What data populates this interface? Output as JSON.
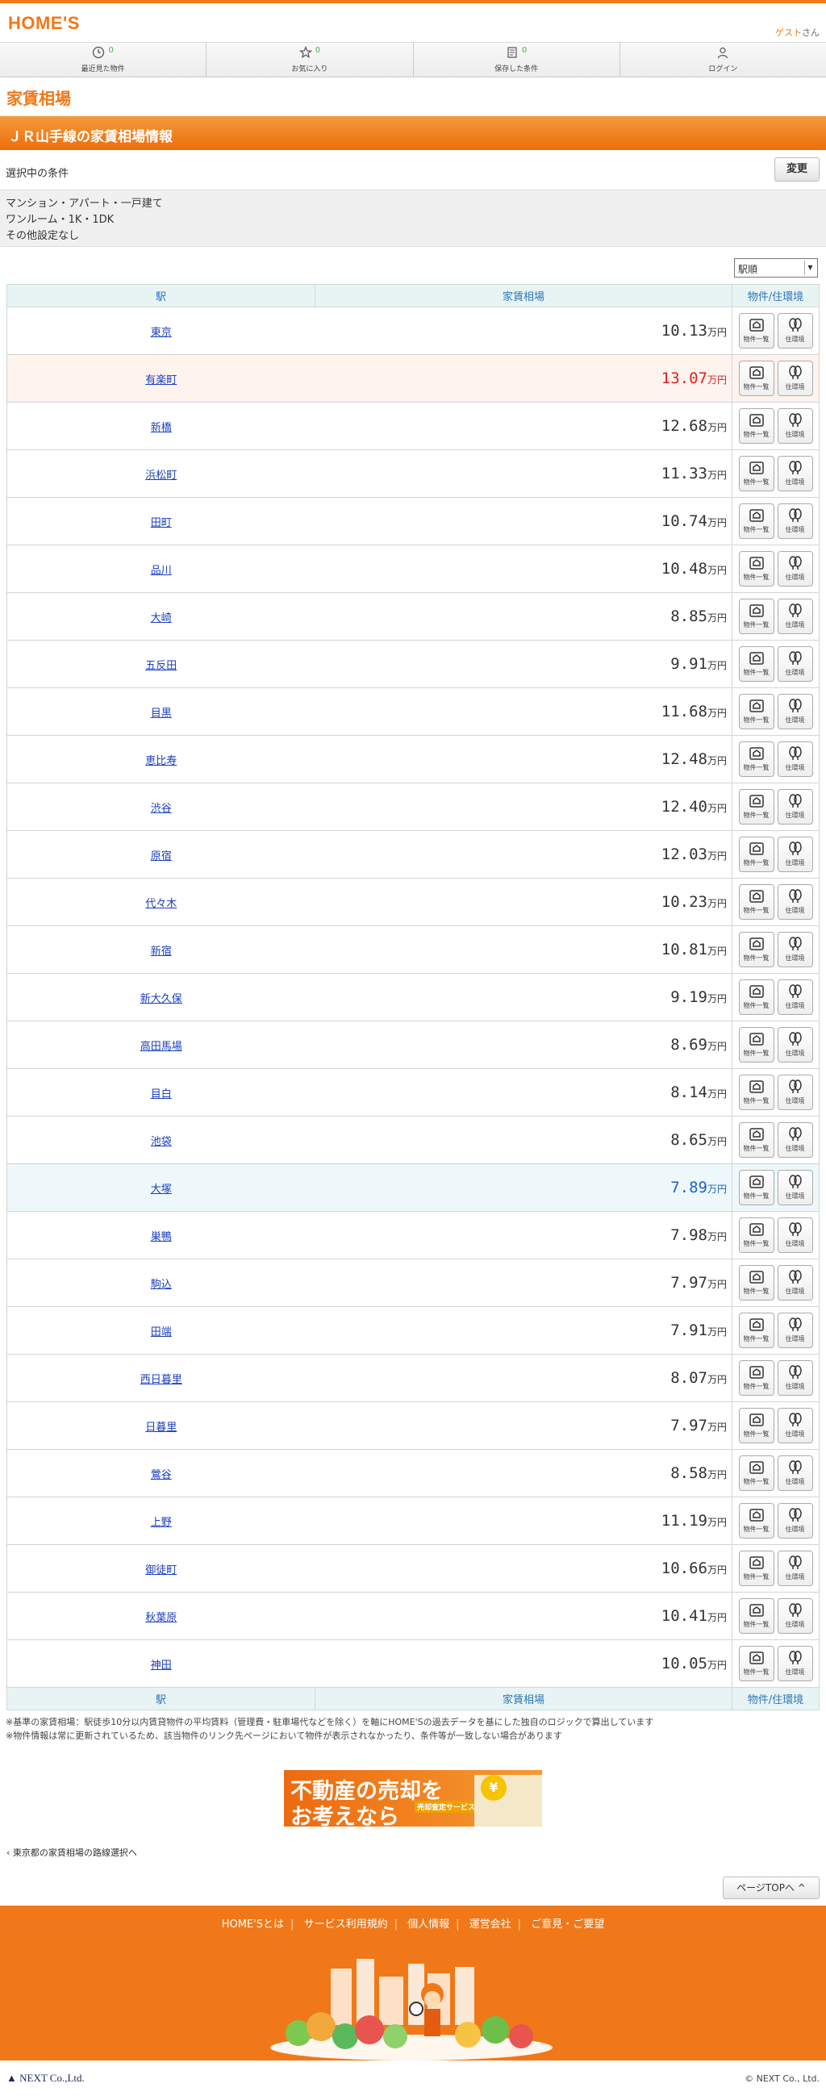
{
  "header": {
    "logo_text": "HOME'S",
    "guest_name": "ゲスト",
    "guest_suffix": "さん"
  },
  "nav": [
    {
      "label": "最近見た物件",
      "count": "0",
      "icon": "clock-icon"
    },
    {
      "label": "お気に入り",
      "count": "0",
      "icon": "star-icon"
    },
    {
      "label": "保存した条件",
      "count": "0",
      "icon": "document-icon"
    },
    {
      "label": "ログイン",
      "count": "",
      "icon": "person-icon"
    }
  ],
  "brand": {
    "sub_title": "家賃相場"
  },
  "page_title": "ＪＲ山手線の家賃相場情報",
  "conditions": {
    "heading": "選択中の条件",
    "change_label": "変更",
    "lines": [
      "マンション・アパート・一戸建て",
      "ワンルーム・1K・1DK",
      "その他設定なし"
    ]
  },
  "sort": {
    "selected": "駅順"
  },
  "table": {
    "headers": {
      "station": "駅",
      "rent": "家賃相場",
      "links": "物件/住環境"
    },
    "unit": "万円",
    "button_labels": {
      "list": "物件一覧",
      "env": "住環境"
    },
    "rows": [
      {
        "station": "東京",
        "rent": "10.13",
        "flag": ""
      },
      {
        "station": "有楽町",
        "rent": "13.07",
        "flag": "high"
      },
      {
        "station": "新橋",
        "rent": "12.68",
        "flag": ""
      },
      {
        "station": "浜松町",
        "rent": "11.33",
        "flag": ""
      },
      {
        "station": "田町",
        "rent": "10.74",
        "flag": ""
      },
      {
        "station": "品川",
        "rent": "10.48",
        "flag": ""
      },
      {
        "station": "大崎",
        "rent": "8.85",
        "flag": ""
      },
      {
        "station": "五反田",
        "rent": "9.91",
        "flag": ""
      },
      {
        "station": "目黒",
        "rent": "11.68",
        "flag": ""
      },
      {
        "station": "恵比寿",
        "rent": "12.48",
        "flag": ""
      },
      {
        "station": "渋谷",
        "rent": "12.40",
        "flag": ""
      },
      {
        "station": "原宿",
        "rent": "12.03",
        "flag": ""
      },
      {
        "station": "代々木",
        "rent": "10.23",
        "flag": ""
      },
      {
        "station": "新宿",
        "rent": "10.81",
        "flag": ""
      },
      {
        "station": "新大久保",
        "rent": "9.19",
        "flag": ""
      },
      {
        "station": "高田馬場",
        "rent": "8.69",
        "flag": ""
      },
      {
        "station": "目白",
        "rent": "8.14",
        "flag": ""
      },
      {
        "station": "池袋",
        "rent": "8.65",
        "flag": ""
      },
      {
        "station": "大塚",
        "rent": "7.89",
        "flag": "low"
      },
      {
        "station": "巣鴨",
        "rent": "7.98",
        "flag": ""
      },
      {
        "station": "駒込",
        "rent": "7.97",
        "flag": ""
      },
      {
        "station": "田端",
        "rent": "7.91",
        "flag": ""
      },
      {
        "station": "西日暮里",
        "rent": "8.07",
        "flag": ""
      },
      {
        "station": "日暮里",
        "rent": "7.97",
        "flag": ""
      },
      {
        "station": "鶯谷",
        "rent": "8.58",
        "flag": ""
      },
      {
        "station": "上野",
        "rent": "11.19",
        "flag": ""
      },
      {
        "station": "御徒町",
        "rent": "10.66",
        "flag": ""
      },
      {
        "station": "秋葉原",
        "rent": "10.41",
        "flag": ""
      },
      {
        "station": "神田",
        "rent": "10.05",
        "flag": ""
      }
    ]
  },
  "notes": [
    "※基準の家賃相場：駅徒歩10分以内賃貸物件の平均賃料（管理費・駐車場代などを除く）を軸にHOME'Sの過去データを基にした独自のロジックで算出しています",
    "※物件情報は常に更新されているため、該当物件のリンク先ページにおいて物件が表示されなかったり、条件等が一致しない場合があります"
  ],
  "banner": {
    "line1": "不動産の売却を",
    "line2": "お考えなら",
    "tag": "売却査定サービスで査定を依頼！",
    "yen": "¥"
  },
  "back_link": "東京都の家賃相場の路線選択へ",
  "page_top": "ページTOPへ",
  "footer": {
    "links": [
      "HOME'Sとは",
      "サービス利用規約",
      "個人情報",
      "運営会社",
      "ご意見・ご要望"
    ],
    "company": "NEXT Co.,Ltd.",
    "copyright": "© NEXT Co., Ltd."
  },
  "colors": {
    "brand": "#f07818",
    "high": "#e02020",
    "low": "#2060c0",
    "link": "#1a3fbf"
  }
}
